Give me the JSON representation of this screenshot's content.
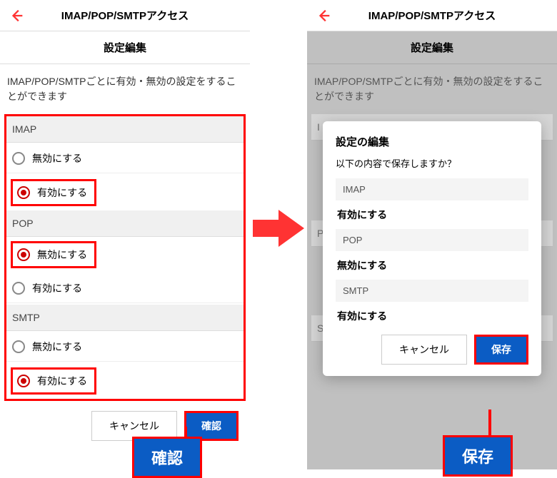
{
  "header": {
    "title": "IMAP/POP/SMTPアクセス"
  },
  "subheader": "設定編集",
  "description": "IMAP/POP/SMTPごとに有効・無効の設定をすることができます",
  "sections": [
    {
      "name": "IMAP",
      "disable": "無効にする",
      "enable": "有効にする",
      "selected": "enable"
    },
    {
      "name": "POP",
      "disable": "無効にする",
      "enable": "有効にする",
      "selected": "disable"
    },
    {
      "name": "SMTP",
      "disable": "無効にする",
      "enable": "有効にする",
      "selected": "enable"
    }
  ],
  "buttons": {
    "cancel": "キャンセル",
    "confirm": "確認",
    "save": "保存"
  },
  "callouts": {
    "confirm": "確認",
    "save": "保存"
  },
  "dialog": {
    "title": "設定の編集",
    "subtitle": "以下の内容で保存しますか？",
    "items": [
      {
        "label": "IMAP",
        "value": "有効にする"
      },
      {
        "label": "POP",
        "value": "無効にする"
      },
      {
        "label": "SMTP",
        "value": "有効にする"
      }
    ]
  },
  "bg_letters": {
    "i": "I",
    "p": "P",
    "s": "S"
  }
}
